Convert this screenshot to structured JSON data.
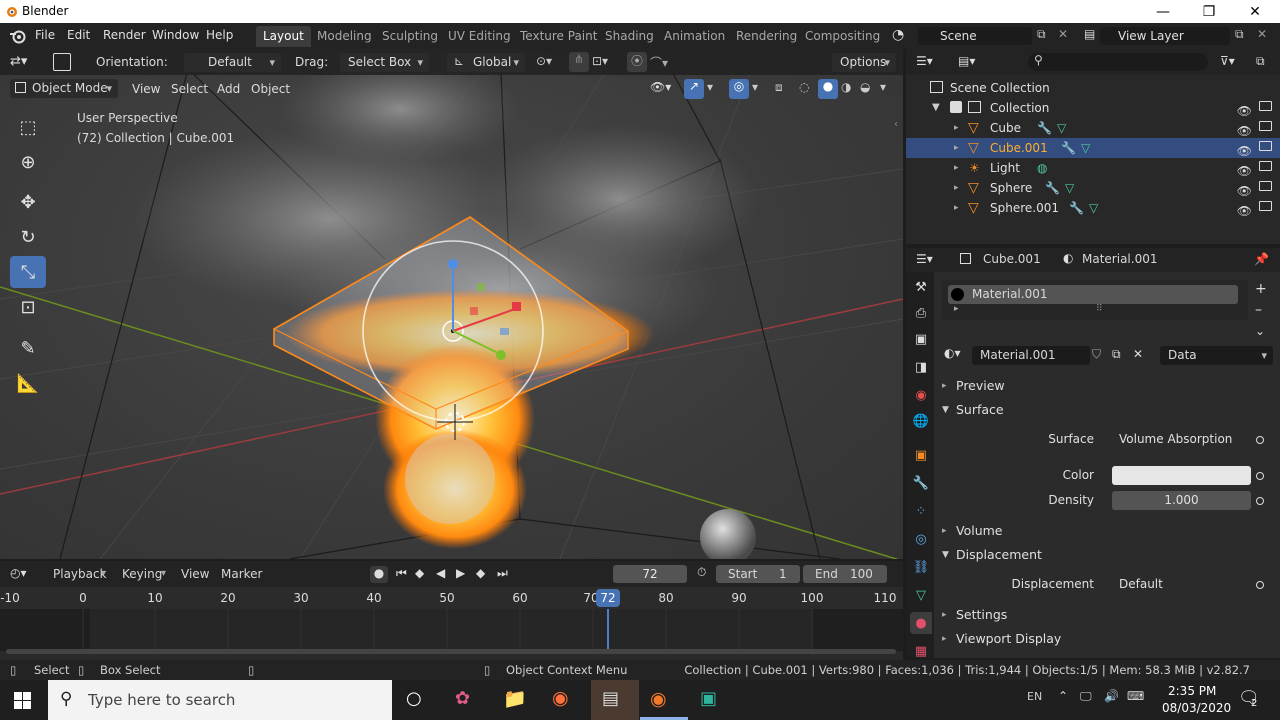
{
  "window": {
    "title": "Blender"
  },
  "menubar": {
    "items": [
      "File",
      "Edit",
      "Render",
      "Window",
      "Help"
    ],
    "workspaces": [
      "Layout",
      "Modeling",
      "Sculpting",
      "UV Editing",
      "Texture Paint",
      "Shading",
      "Animation",
      "Rendering",
      "Compositing"
    ],
    "active_workspace": "Layout",
    "scene": "Scene",
    "view_layer": "View Layer"
  },
  "viewport": {
    "header": {
      "orientation_label": "Orientation:",
      "orientation_value": "Default",
      "drag_label": "Drag:",
      "drag_value": "Select Box",
      "transform_value": "Global",
      "options_label": "Options",
      "mode": "Object Mode",
      "menus": [
        "View",
        "Select",
        "Add",
        "Object"
      ]
    },
    "overlay_text": {
      "perspective": "User Perspective",
      "collection": "(72) Collection | Cube.001"
    }
  },
  "timeline": {
    "menus": [
      "Playback",
      "Keying",
      "View",
      "Marker"
    ],
    "current_frame": "72",
    "start_label": "Start",
    "start_value": "1",
    "end_label": "End",
    "end_value": "100",
    "ruler_ticks": [
      "-10",
      "0",
      "10",
      "20",
      "30",
      "40",
      "50",
      "60",
      "70",
      "80",
      "90",
      "100",
      "110"
    ],
    "playhead_label": "72"
  },
  "outliner": {
    "root": "Scene Collection",
    "collection": "Collection",
    "objects": [
      {
        "name": "Cube",
        "selected": false
      },
      {
        "name": "Cube.001",
        "selected": true
      },
      {
        "name": "Light",
        "selected": false
      },
      {
        "name": "Sphere",
        "selected": false
      },
      {
        "name": "Sphere.001",
        "selected": false
      }
    ]
  },
  "properties": {
    "breadcrumb_object": "Cube.001",
    "breadcrumb_material": "Material.001",
    "slot": "Material.001",
    "material_name": "Material.001",
    "link": "Data",
    "panels": {
      "preview": "Preview",
      "surface": "Surface",
      "volume": "Volume",
      "displacement": "Displacement",
      "settings": "Settings",
      "viewport_display": "Viewport Display"
    },
    "surface_label": "Surface",
    "surface_value": "Volume Absorption",
    "color_label": "Color",
    "color_value": "#e6e6e6",
    "density_label": "Density",
    "density_value": "1.000",
    "displacement_label": "Displacement",
    "displacement_value": "Default"
  },
  "statusbar": {
    "select": "Select",
    "box_select": "Box Select",
    "context_menu": "Object Context Menu",
    "info": "Collection | Cube.001 | Verts:980 | Faces:1,036 | Tris:1,944 | Objects:1/5 | Mem: 58.3 MiB | v2.82.7"
  },
  "taskbar": {
    "search_placeholder": "Type here to search",
    "lang": "EN",
    "time": "2:35 PM",
    "date": "08/03/2020",
    "notifications": "2"
  }
}
